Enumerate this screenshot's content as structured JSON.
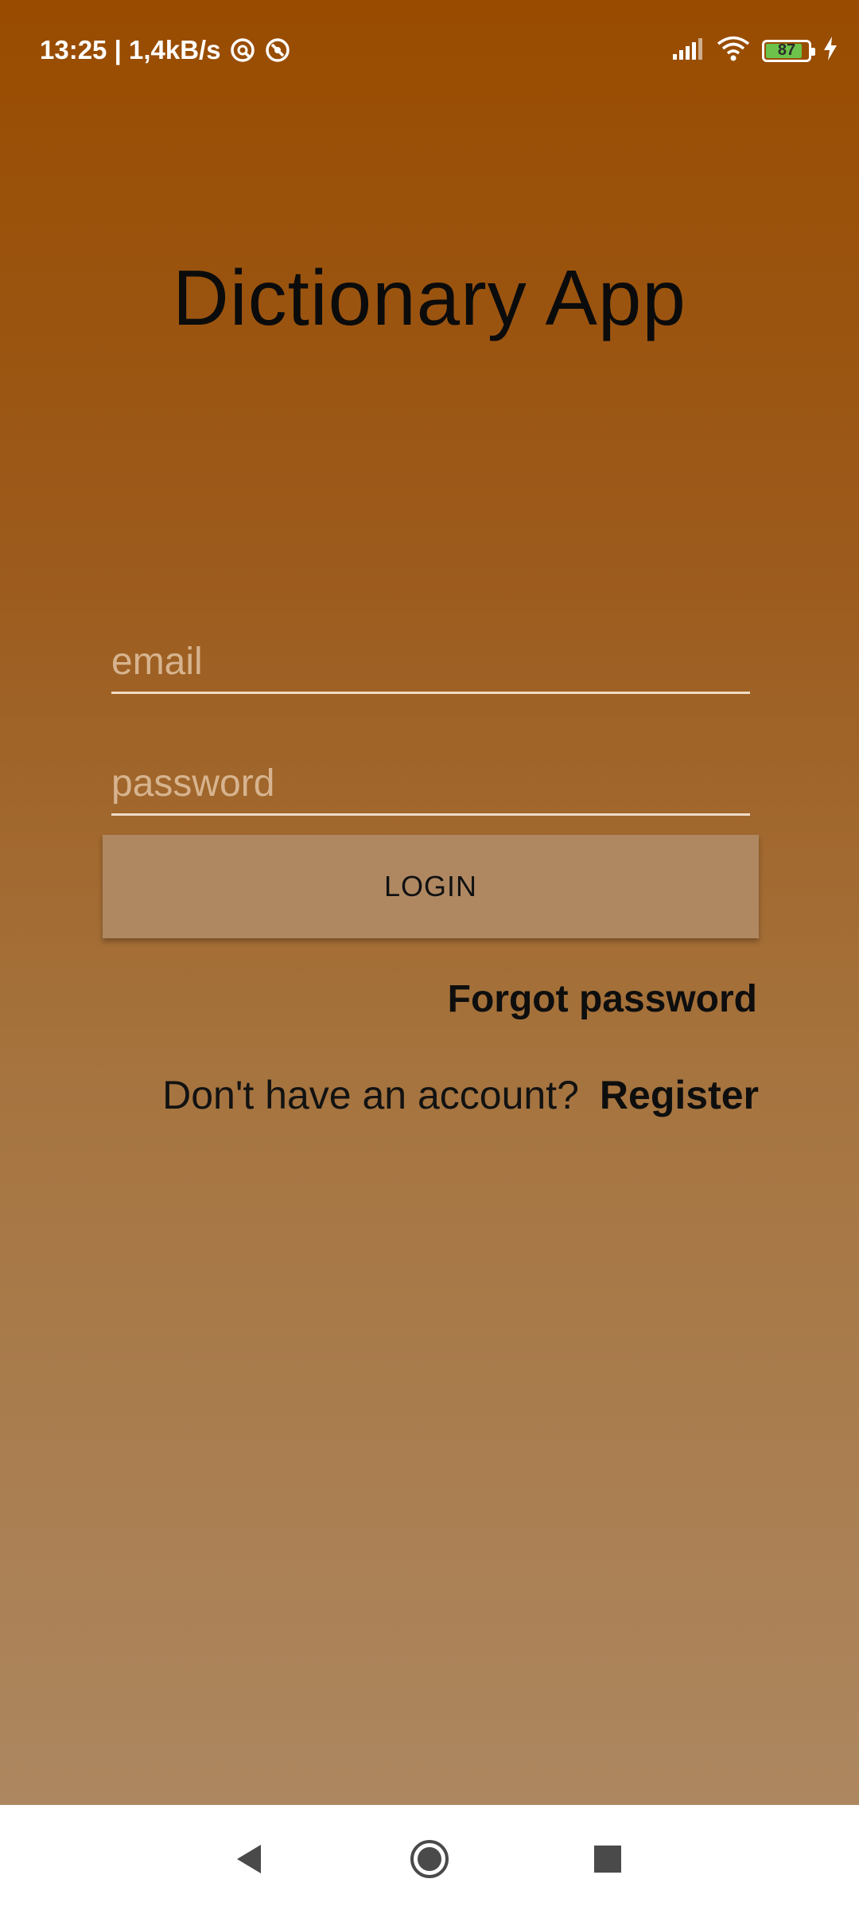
{
  "status_bar": {
    "time_and_speed": "13:25 | 1,4kB/s",
    "battery_level": "87",
    "battery_fraction": 0.87,
    "icons": [
      "vpn-icon",
      "sync-icon",
      "signal-icon",
      "wifi-icon",
      "battery-icon",
      "charging-icon"
    ]
  },
  "app": {
    "title": "Dictionary App"
  },
  "login_form": {
    "email_placeholder": "email",
    "email_value": "",
    "password_placeholder": "password",
    "password_value": "",
    "login_label": "LOGIN",
    "forgot_password_label": "Forgot password",
    "no_account_text": "Don't have an account?",
    "register_label": "Register"
  },
  "nav_bar": {
    "icons": [
      "back-icon",
      "home-icon",
      "recents-icon"
    ]
  },
  "colors": {
    "gradient_top": "#994c00",
    "gradient_bottom": "#ad8760",
    "button": "#af8862",
    "battery_fill": "#6cc24a"
  }
}
